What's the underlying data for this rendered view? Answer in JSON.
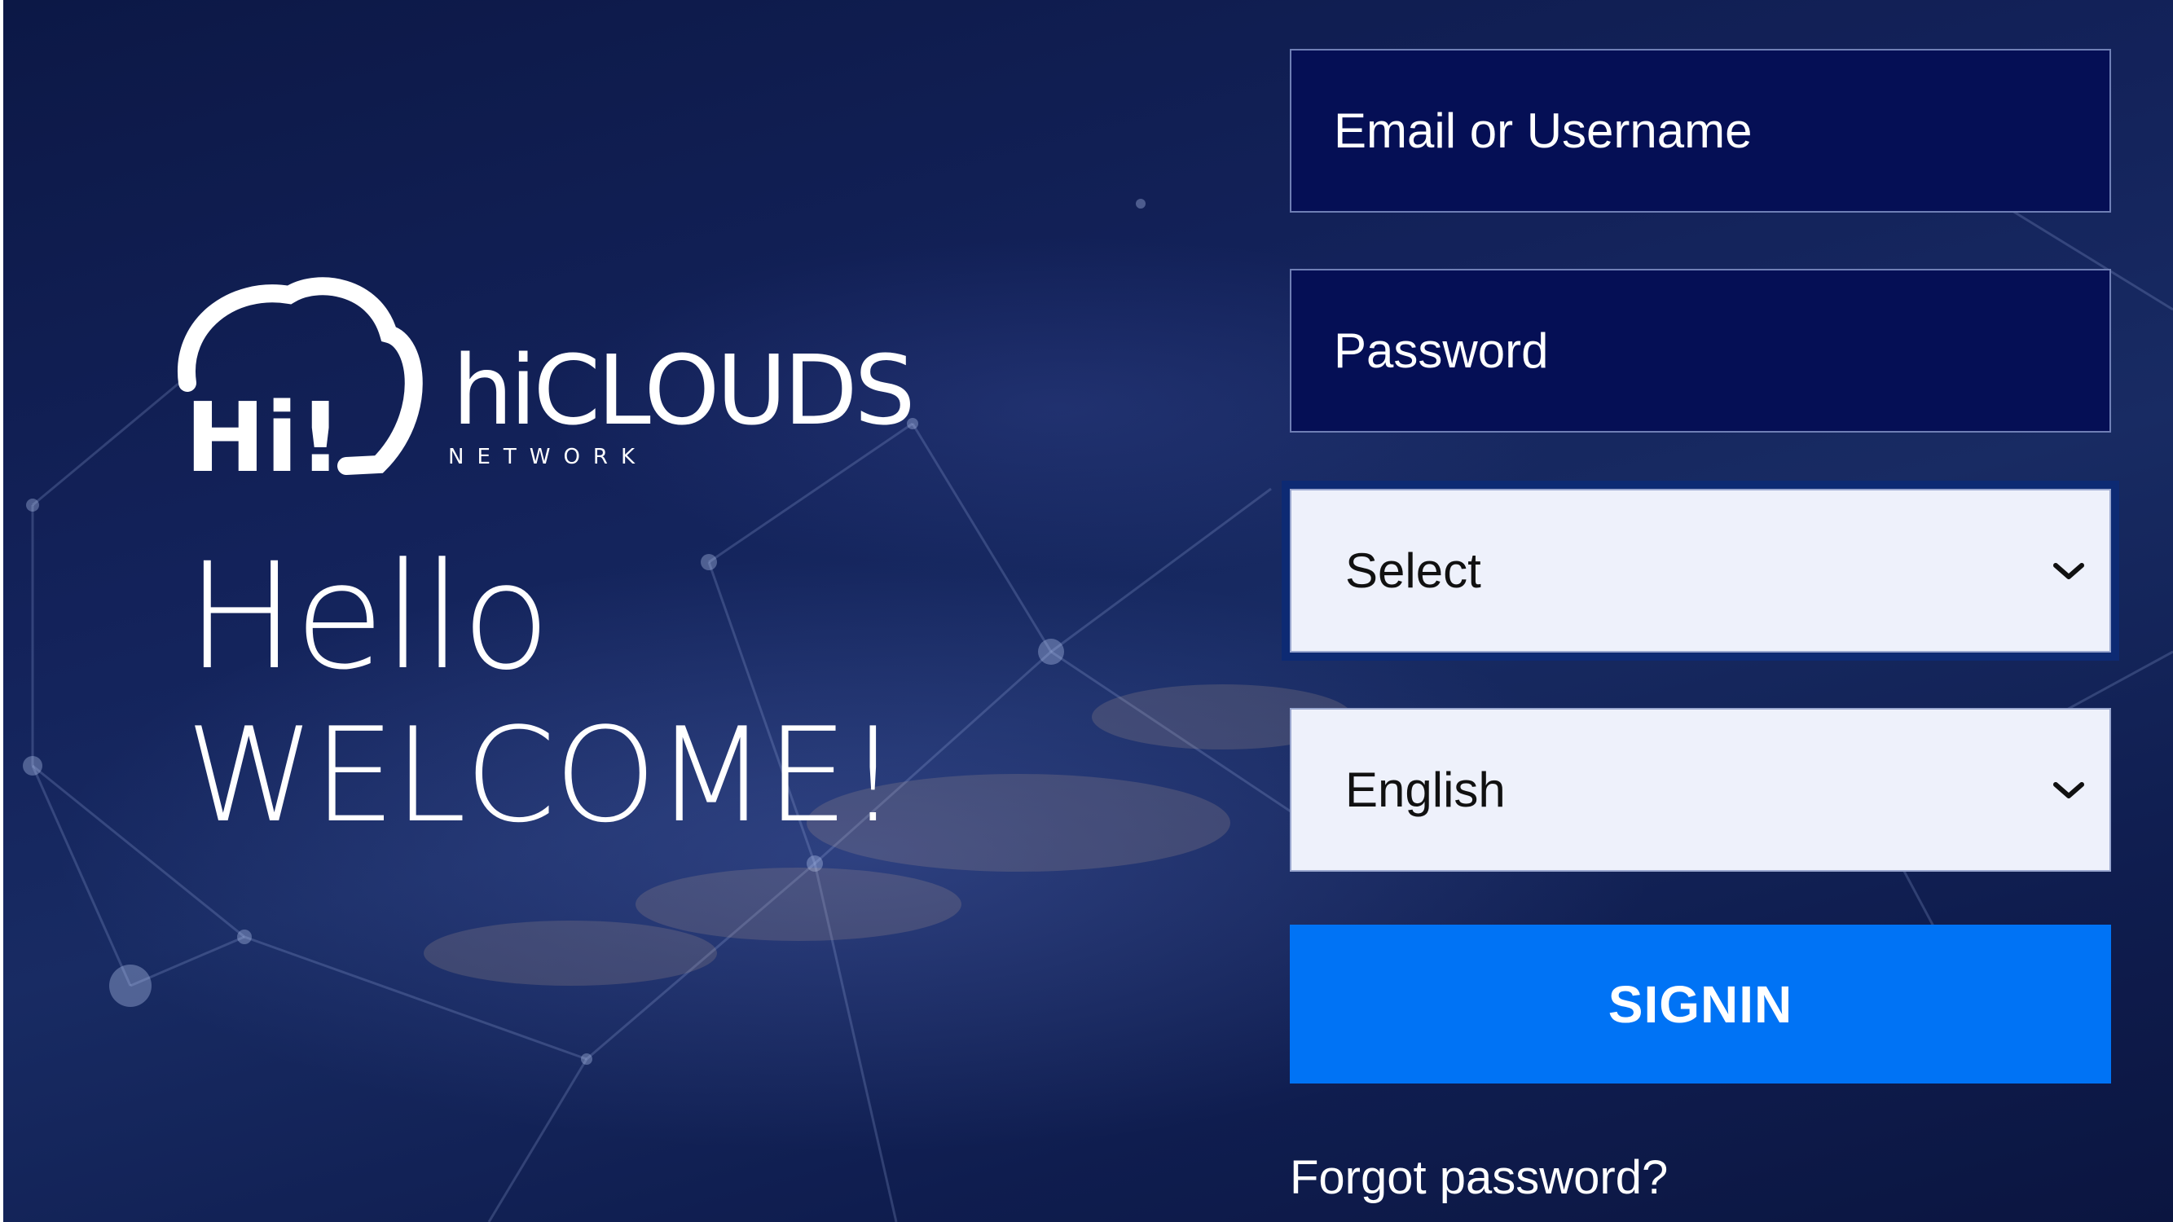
{
  "brand": {
    "logo_mark": "Hi!",
    "name": "hiCLOUDS",
    "subtitle": "NETWORK"
  },
  "greeting": {
    "line1": "Hello",
    "line2": "WELCOME!"
  },
  "form": {
    "email_placeholder": "Email or Username",
    "password_placeholder": "Password",
    "role_select": {
      "selected": "Select",
      "icon": "chevron-down-icon"
    },
    "language_select": {
      "selected": "English",
      "icon": "chevron-down-icon"
    },
    "signin_label": "SIGNIN",
    "forgot_label": "Forgot password?"
  },
  "colors": {
    "background": "#13225a",
    "input_background": "#050f55",
    "select_background": "#eef1fb",
    "button": "#0073f5",
    "text": "#ffffff"
  }
}
